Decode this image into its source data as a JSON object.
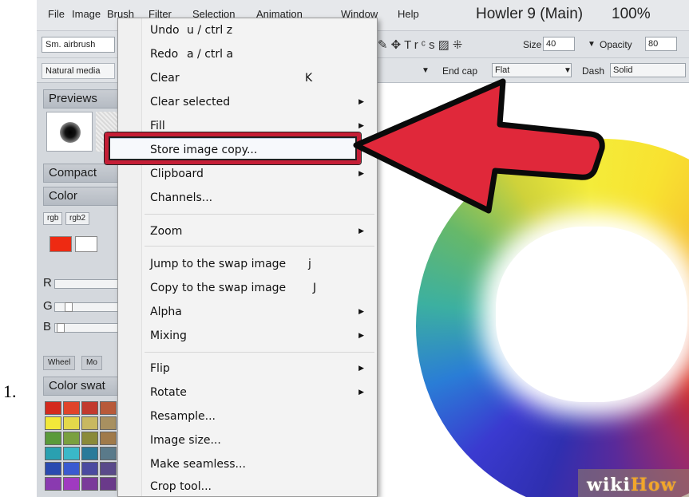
{
  "step_number": "1.",
  "app": {
    "title": "Howler 9 (Main)",
    "zoom": "100%",
    "menubar": [
      "File",
      "Image",
      "Brush",
      "Filter",
      "Selection",
      "Animation",
      "Window",
      "Help"
    ]
  },
  "toolbar": {
    "brush_name": "Sm. airbrush",
    "brush_category": "Natural media",
    "size_label": "Size",
    "size_value": "40",
    "opacity_label": "Opacity",
    "opacity_value": "80",
    "endcap_label": "End cap",
    "endcap_value": "Flat",
    "dash_label": "Dash",
    "dash_value": "Solid"
  },
  "panels": {
    "previews": "Previews",
    "compact": "Compact",
    "color": "Color",
    "color_tabs": [
      "rgb",
      "rgb2"
    ],
    "sliders": [
      "R",
      "G",
      "B"
    ],
    "wheel_tabs": [
      "Wheel",
      "Mo"
    ],
    "swatches": "Color swat",
    "fg_color": "#ee2a12",
    "bg_color": "#ffffff"
  },
  "menu": {
    "items": [
      {
        "label": "Undo",
        "shortcut": "u / ctrl z",
        "submenu": false
      },
      {
        "label": "Redo",
        "shortcut": "a / ctrl a",
        "submenu": false
      },
      {
        "label": "Clear",
        "shortcut": "K",
        "submenu": false
      },
      {
        "label": "Clear selected",
        "shortcut": "",
        "submenu": true
      },
      {
        "label": "Fill",
        "shortcut": "",
        "submenu": true
      },
      {
        "label": "Store image copy...",
        "shortcut": "",
        "submenu": false,
        "highlighted": true
      },
      {
        "label": "Clipboard",
        "shortcut": "",
        "submenu": true
      },
      {
        "label": "Channels...",
        "shortcut": "",
        "submenu": false
      },
      {
        "label": "Zoom",
        "shortcut": "",
        "submenu": true
      },
      {
        "label": "Jump to the swap image",
        "shortcut": "j",
        "submenu": false
      },
      {
        "label": "Copy to the swap image",
        "shortcut": "J",
        "submenu": false
      },
      {
        "label": "Alpha",
        "shortcut": "",
        "submenu": true
      },
      {
        "label": "Mixing",
        "shortcut": "",
        "submenu": true
      },
      {
        "label": "Flip",
        "shortcut": "",
        "submenu": true
      },
      {
        "label": "Rotate",
        "shortcut": "",
        "submenu": true
      },
      {
        "label": "Resample...",
        "shortcut": "",
        "submenu": false
      },
      {
        "label": "Image size...",
        "shortcut": "",
        "submenu": false
      },
      {
        "label": "Make seamless...",
        "shortcut": "",
        "submenu": false
      },
      {
        "label": "Crop tool...",
        "shortcut": "",
        "submenu": false
      }
    ]
  },
  "watermark": {
    "part1": "wiki",
    "part2": "How"
  },
  "colors": {
    "highlight_box": "#c51e36",
    "arrow": "#e0283a"
  }
}
